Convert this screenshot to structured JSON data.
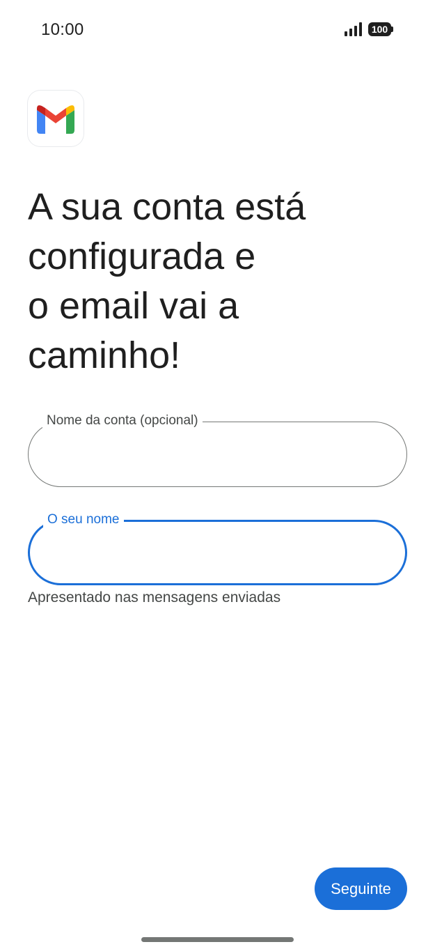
{
  "status_bar": {
    "time": "10:00",
    "signal_icon": "signal-bars-icon",
    "battery_level": "100"
  },
  "app": {
    "logo_icon": "gmail-logo-icon",
    "brand_colors": {
      "blue": "#4285F4",
      "red": "#EA4335",
      "yellow": "#FBBC04",
      "green": "#34A853",
      "dark_red": "#C5221F"
    }
  },
  "headline": {
    "line1": "A sua conta está",
    "line2": "configurada e",
    "line3": "o email vai a",
    "line4": "caminho!"
  },
  "form": {
    "account_name": {
      "label": "Nome da conta (opcional)",
      "value": ""
    },
    "sender_name": {
      "label": "O seu nome",
      "value": "",
      "helper": "Apresentado nas mensagens enviadas",
      "focused": true
    }
  },
  "actions": {
    "next_label": "Seguinte"
  },
  "colors": {
    "accent": "#1B6FD8",
    "text": "#1F1F1F",
    "secondary_text": "#444746",
    "outline": "#747775"
  }
}
